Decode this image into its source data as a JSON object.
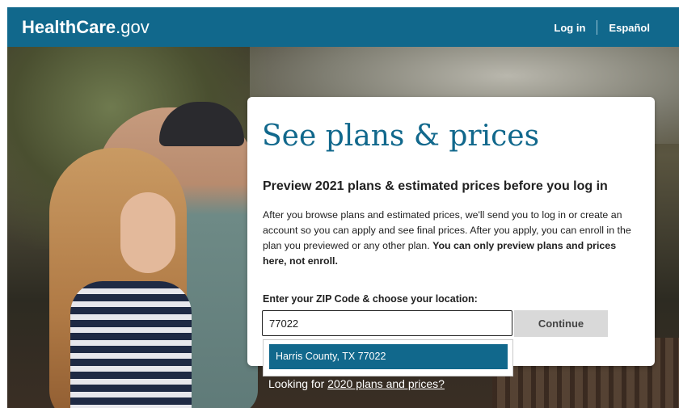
{
  "header": {
    "logo_bold": "HealthCare",
    "logo_light": ".gov",
    "login_label": "Log in",
    "language_label": "Español"
  },
  "card": {
    "title": "See plans & prices",
    "subtitle": "Preview 2021 plans & estimated prices before you log in",
    "description": "After you browse plans and estimated prices, we'll send you to log in or create an account so you can apply and see final prices. After you apply, you can enroll in the plan you previewed or any other plan. ",
    "description_bold": "You can only preview plans and prices here, not enroll.",
    "zip_label": "Enter your ZIP Code & choose your location:",
    "zip_value": "77022",
    "continue_label": "Continue"
  },
  "location_dropdown": {
    "options": [
      "Harris County, TX 77022"
    ]
  },
  "footer_link": {
    "prefix": "Looking for ",
    "link_text": "2020 plans and prices?"
  },
  "colors": {
    "brand": "#11688c",
    "button_disabled": "#d9d9d9"
  }
}
